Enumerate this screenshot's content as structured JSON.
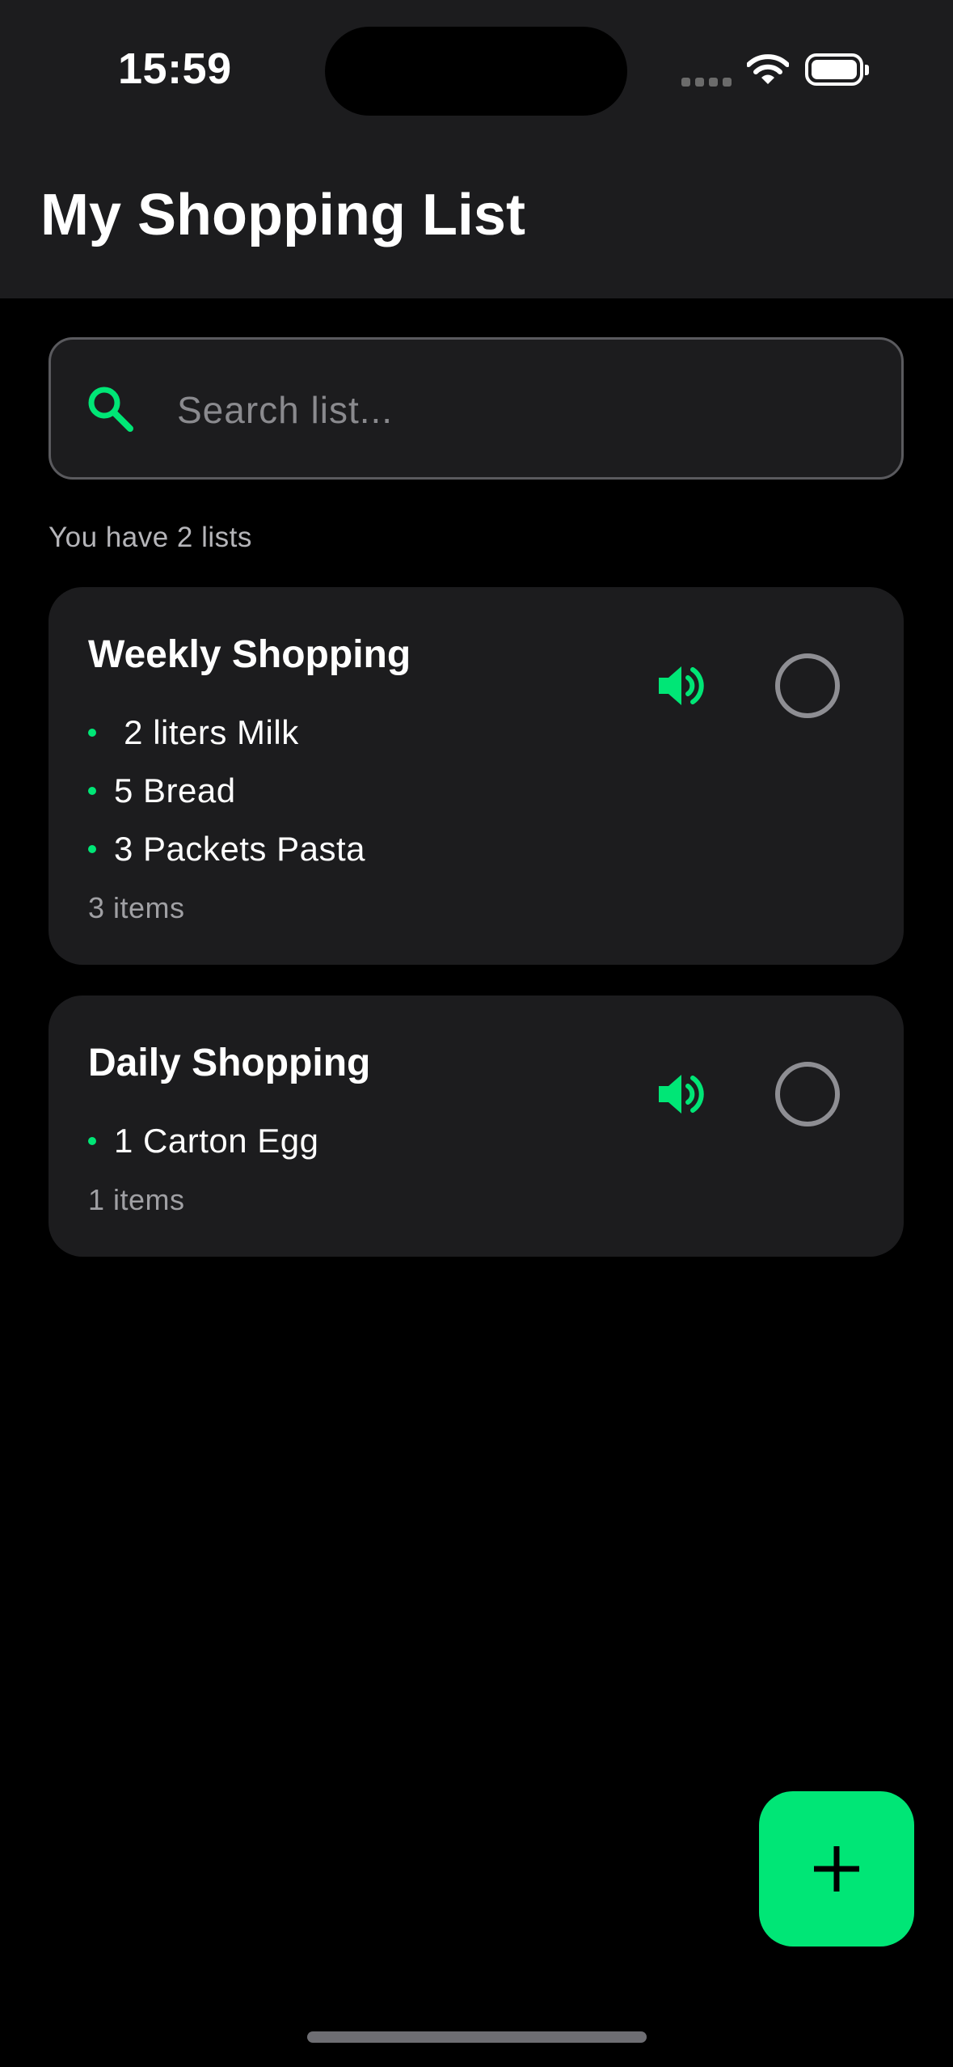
{
  "status_bar": {
    "time": "15:59",
    "signal_icon": "cellular-signal-icon",
    "wifi_icon": "wifi-icon",
    "battery_icon": "battery-icon"
  },
  "header": {
    "title": "My Shopping List"
  },
  "search": {
    "placeholder": "Search list...",
    "value": "",
    "icon": "search-icon"
  },
  "summary": {
    "text": "You have 2 lists"
  },
  "lists": [
    {
      "title": "Weekly Shopping",
      "items": [
        " 2 liters Milk",
        "5 Bread",
        "3 Packets Pasta"
      ],
      "count_label": "3 items",
      "speaker_icon": "speaker-icon",
      "checked": false
    },
    {
      "title": "Daily Shopping",
      "items": [
        "1 Carton Egg"
      ],
      "count_label": "1 items",
      "speaker_icon": "speaker-icon",
      "checked": false
    }
  ],
  "fab": {
    "icon": "plus-icon"
  },
  "colors": {
    "accent": "#00e676",
    "background": "#000000",
    "surface": "#1c1c1e",
    "secondary_text": "#a0a0a4"
  }
}
